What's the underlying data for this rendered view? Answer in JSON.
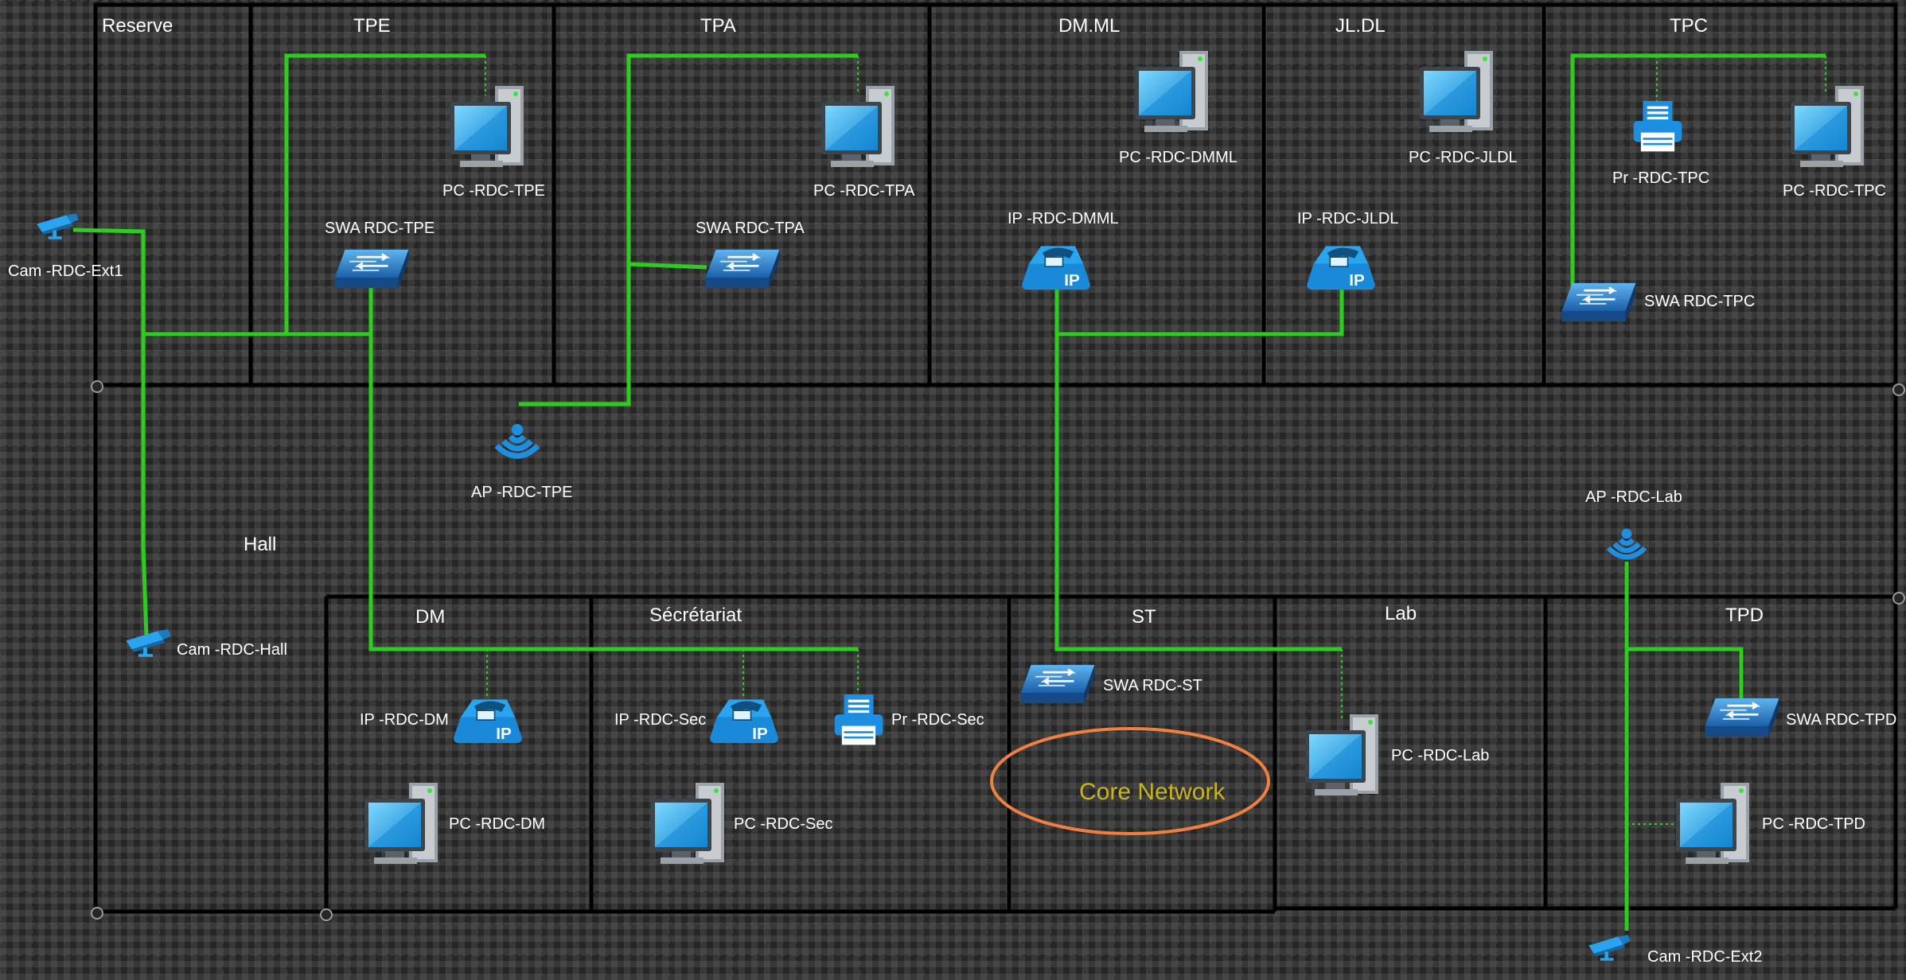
{
  "rooms": {
    "reserve": "Reserve",
    "tpe": "TPE",
    "tpa": "TPA",
    "dmml": "DM.ML",
    "jldl": "JL.DL",
    "tpc": "TPC",
    "hall": "Hall",
    "dm": "DM",
    "secretariat": "Sécrétariat",
    "st": "ST",
    "lab": "Lab",
    "tpd": "TPD"
  },
  "devices": {
    "cam_ext1": "Cam -RDC-Ext1",
    "cam_hall": "Cam -RDC-Hall",
    "cam_ext2": "Cam -RDC-Ext2",
    "pc_tpe": "PC -RDC-TPE",
    "swa_tpe": "SWA RDC-TPE",
    "pc_tpa": "PC -RDC-TPA",
    "swa_tpa": "SWA RDC-TPA",
    "ap_tpe": "AP -RDC-TPE",
    "pc_dmml": "PC -RDC-DMML",
    "ip_dmml": "IP -RDC-DMML",
    "pc_jldl": "PC -RDC-JLDL",
    "ip_jldl": "IP -RDC-JLDL",
    "pr_tpc": "Pr -RDC-TPC",
    "pc_tpc": "PC -RDC-TPC",
    "swa_tpc": "SWA RDC-TPC",
    "ap_lab": "AP -RDC-Lab",
    "ip_dm": "IP -RDC-DM",
    "pc_dm": "PC -RDC-DM",
    "ip_sec": "IP -RDC-Sec",
    "pc_sec": "PC -RDC-Sec",
    "pr_sec": "Pr -RDC-Sec",
    "swa_st": "SWA RDC-ST",
    "pc_lab": "PC -RDC-Lab",
    "swa_tpd": "SWA RDC-TPD",
    "pc_tpd": "PC -RDC-TPD"
  },
  "core_label": "Core Network",
  "phone_badge": "IP",
  "colors": {
    "background": "#262626",
    "wall": "#000000",
    "link": "#2ecc1f",
    "device": "#1ea0e6",
    "core_ring": "#f08040",
    "core_text": "#c8b41e"
  }
}
